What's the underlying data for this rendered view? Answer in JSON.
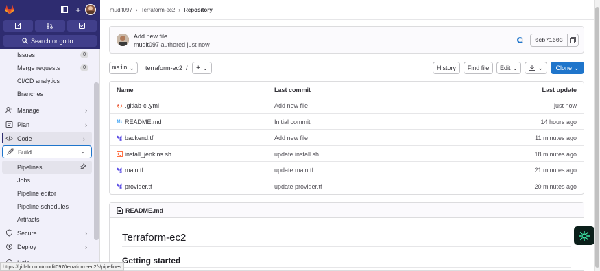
{
  "sidebar": {
    "search_label": "Search or go to...",
    "items": [
      {
        "label": "Issues",
        "count": "0"
      },
      {
        "label": "Merge requests",
        "count": "0"
      },
      {
        "label": "CI/CD analytics"
      },
      {
        "label": "Branches"
      },
      {
        "label": "Manage"
      },
      {
        "label": "Plan"
      },
      {
        "label": "Code"
      },
      {
        "label": "Build"
      },
      {
        "label": "Pipelines"
      },
      {
        "label": "Jobs"
      },
      {
        "label": "Pipeline editor"
      },
      {
        "label": "Pipeline schedules"
      },
      {
        "label": "Artifacts"
      },
      {
        "label": "Secure"
      },
      {
        "label": "Deploy"
      },
      {
        "label": "Help"
      }
    ]
  },
  "status_url": "https://gitlab.com/mudit097/terraform-ec2/-/pipelines",
  "breadcrumb": {
    "user": "mudit097",
    "project": "Terraform-ec2",
    "current": "Repository"
  },
  "commit": {
    "title": "Add new file",
    "author": "mudit097",
    "authored": "authored just now",
    "sha": "0cb71603"
  },
  "toolbar": {
    "branch": "main",
    "path": "terraform-ec2",
    "path_sep": "/",
    "add": "+",
    "history": "History",
    "find_file": "Find file",
    "edit": "Edit",
    "clone": "Clone"
  },
  "table": {
    "headers": [
      "Name",
      "Last commit",
      "Last update"
    ],
    "rows": [
      {
        "name": ".gitlab-ci.yml",
        "commit": "Add new file",
        "updated": "just now"
      },
      {
        "name": "README.md",
        "commit": "Initial commit",
        "updated": "14 hours ago"
      },
      {
        "name": "backend.tf",
        "commit": "Add new file",
        "updated": "11 minutes ago"
      },
      {
        "name": "install_jenkins.sh",
        "commit": "update install.sh",
        "updated": "18 minutes ago"
      },
      {
        "name": "main.tf",
        "commit": "update main.tf",
        "updated": "21 minutes ago"
      },
      {
        "name": "provider.tf",
        "commit": "update provider.tf",
        "updated": "20 minutes ago"
      }
    ]
  },
  "readme": {
    "filename": "README.md",
    "h1": "Terraform-ec2",
    "h2": "Getting started"
  },
  "colors": {
    "sidebar_top": "#2e2c70",
    "accent": "#1f75cb",
    "gitlab_orange": "#fc6d26"
  }
}
